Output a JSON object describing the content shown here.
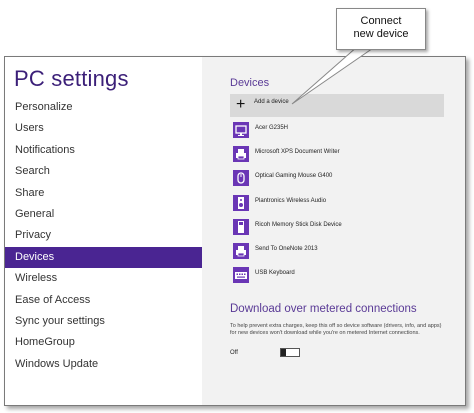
{
  "callout": {
    "line1": "Connect",
    "line2": "new device"
  },
  "app": {
    "title": "PC settings"
  },
  "nav": {
    "items": [
      {
        "label": "Personalize",
        "selected": false
      },
      {
        "label": "Users",
        "selected": false
      },
      {
        "label": "Notifications",
        "selected": false
      },
      {
        "label": "Search",
        "selected": false
      },
      {
        "label": "Share",
        "selected": false
      },
      {
        "label": "General",
        "selected": false
      },
      {
        "label": "Privacy",
        "selected": false
      },
      {
        "label": "Devices",
        "selected": true
      },
      {
        "label": "Wireless",
        "selected": false
      },
      {
        "label": "Ease of Access",
        "selected": false
      },
      {
        "label": "Sync your settings",
        "selected": false
      },
      {
        "label": "HomeGroup",
        "selected": false
      },
      {
        "label": "Windows Update",
        "selected": false
      }
    ]
  },
  "devices": {
    "heading": "Devices",
    "add_label": "Add a device",
    "add_icon": "plus-icon",
    "list": [
      {
        "name": "Acer G235H",
        "icon": "monitor-icon"
      },
      {
        "name": "Microsoft XPS Document Writer",
        "icon": "printer-icon"
      },
      {
        "name": "Optical Gaming Mouse G400",
        "icon": "mouse-icon"
      },
      {
        "name": "Plantronics Wireless Audio",
        "icon": "speaker-icon"
      },
      {
        "name": "Ricoh Memory Stick Disk Device",
        "icon": "drive-icon"
      },
      {
        "name": "Send To OneNote 2013",
        "icon": "printer-icon"
      },
      {
        "name": "USB Keyboard",
        "icon": "keyboard-icon"
      }
    ]
  },
  "metered": {
    "heading": "Download over metered connections",
    "description": "To help prevent extra charges, keep this off so device software (drivers, info, and apps) for new devices won't download while you're on metered Internet connections.",
    "toggle_label": "Off",
    "toggle_on": false
  },
  "colors": {
    "accent": "#4a2592",
    "title": "#3b1f78",
    "tile": "#6a36b5",
    "right_panel": "#f2f2f2"
  }
}
